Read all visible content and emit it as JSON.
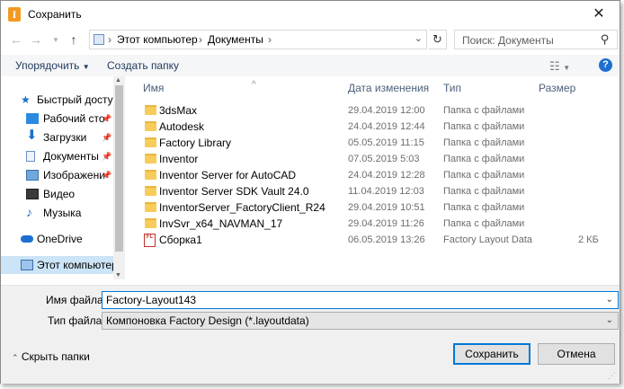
{
  "window": {
    "title": "Сохранить",
    "app_icon_letter": "I"
  },
  "nav": {
    "address_segments": [
      "Этот компьютер",
      "Документы"
    ],
    "search_placeholder": "Поиск: Документы"
  },
  "toolbar": {
    "organize": "Упорядочить",
    "new_folder": "Создать папку",
    "help": "?"
  },
  "sidebar": [
    {
      "label": "Быстрый доступ",
      "icon": "star-icon",
      "pinned": false
    },
    {
      "label": "Рабочий сто",
      "icon": "desktop-icon",
      "pinned": true
    },
    {
      "label": "Загрузки",
      "icon": "download-icon",
      "pinned": true
    },
    {
      "label": "Документы",
      "icon": "documents-icon",
      "pinned": true
    },
    {
      "label": "Изображени",
      "icon": "pictures-icon",
      "pinned": true
    },
    {
      "label": "Видео",
      "icon": "video-icon",
      "pinned": false
    },
    {
      "label": "Музыка",
      "icon": "music-icon",
      "pinned": false
    },
    {
      "label": "OneDrive",
      "icon": "cloud-icon",
      "pinned": false
    },
    {
      "label": "Этот компьютер",
      "icon": "computer-icon",
      "pinned": false
    }
  ],
  "columns": {
    "name": "Имя",
    "date": "Дата изменения",
    "type": "Тип",
    "size": "Размер"
  },
  "files": [
    {
      "name": "3dsMax",
      "date": "29.04.2019 12:00",
      "type": "Папка с файлами",
      "size": "",
      "kind": "folder"
    },
    {
      "name": "Autodesk",
      "date": "24.04.2019 12:44",
      "type": "Папка с файлами",
      "size": "",
      "kind": "folder"
    },
    {
      "name": "Factory Library",
      "date": "05.05.2019 11:15",
      "type": "Папка с файлами",
      "size": "",
      "kind": "folder"
    },
    {
      "name": "Inventor",
      "date": "07.05.2019 5:03",
      "type": "Папка с файлами",
      "size": "",
      "kind": "folder"
    },
    {
      "name": "Inventor Server for AutoCAD",
      "date": "24.04.2019 12:28",
      "type": "Папка с файлами",
      "size": "",
      "kind": "folder"
    },
    {
      "name": "Inventor Server SDK Vault 24.0",
      "date": "11.04.2019 12:03",
      "type": "Папка с файлами",
      "size": "",
      "kind": "folder"
    },
    {
      "name": "InventorServer_FactoryClient_R24",
      "date": "29.04.2019 10:51",
      "type": "Папка с файлами",
      "size": "",
      "kind": "folder"
    },
    {
      "name": "InvSvr_x64_NAVMAN_17",
      "date": "29.04.2019 11:26",
      "type": "Папка с файлами",
      "size": "",
      "kind": "folder"
    },
    {
      "name": "Сборка1",
      "date": "06.05.2019 13:26",
      "type": "Factory Layout Data",
      "size": "2 КБ",
      "kind": "file"
    }
  ],
  "filename": {
    "label": "Имя файла:",
    "value": "Factory-Layout143"
  },
  "filetype": {
    "label": "Тип файла:",
    "value": "Компоновка Factory Design (*.layoutdata)"
  },
  "footer": {
    "hide_folders": "Скрыть папки",
    "save": "Сохранить",
    "cancel": "Отмена"
  },
  "colors": {
    "accent": "#0078d7",
    "selection": "#cce4f7",
    "folder": "#f7cc5a"
  }
}
